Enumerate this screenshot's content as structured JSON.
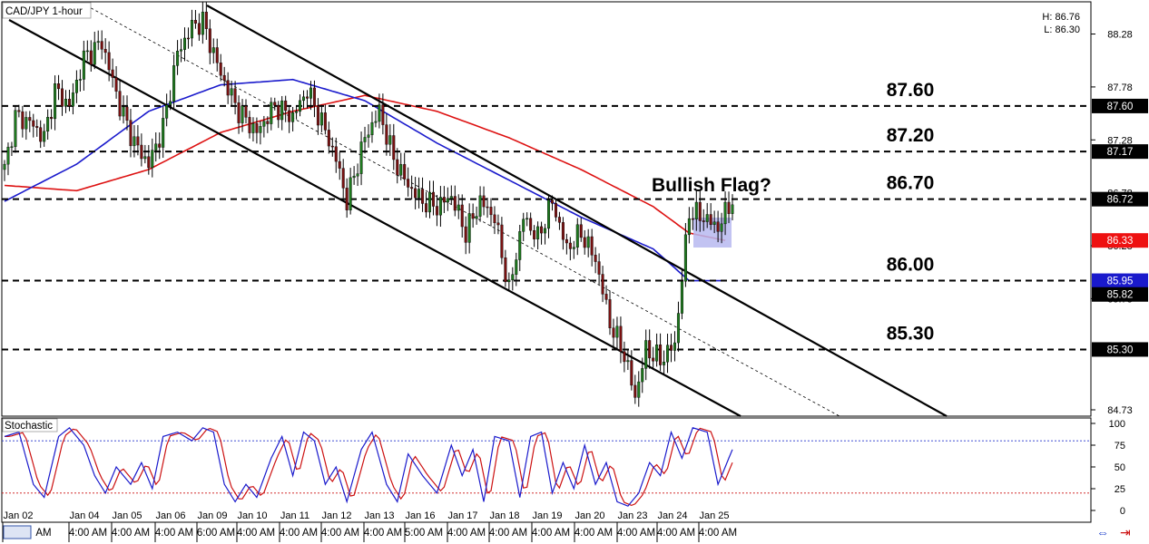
{
  "window": {
    "title": "CAD/JPY 1-hour",
    "stat_high": "H: 86.76",
    "stat_low": "L: 86.30"
  },
  "colors": {
    "price_line": "#000000",
    "candle_up": "#1e7a1e",
    "candle_down": "#7a1111",
    "ma_blue": "#1a1acc",
    "ma_red": "#dd1111",
    "stoch_k": "#1a1acc",
    "stoch_d": "#cc1111",
    "flag_fill": "#b7b8f0",
    "tag_dark": "#000000",
    "tag_red": "#ee1111",
    "tag_blue": "#1a1acc"
  },
  "chart_data": [
    {
      "type": "candlestick",
      "title": "CAD/JPY 1-hour",
      "ylim": [
        84.73,
        88.55
      ],
      "y_ticks": [
        "88.28",
        "87.78",
        "87.28",
        "86.78",
        "86.28",
        "85.78",
        "84.73"
      ],
      "levels": [
        {
          "value": 87.6,
          "label": "87.60",
          "tag": "87.60"
        },
        {
          "value": 87.17,
          "label": "87.20",
          "tag": "87.17"
        },
        {
          "value": 86.72,
          "label": "86.70",
          "tag": "86.72"
        },
        {
          "value": 85.95,
          "label": "86.00",
          "tag": "85.95"
        },
        {
          "value": 85.3,
          "label": "85.30",
          "tag": "85.30"
        }
      ],
      "price_tags": [
        {
          "value": 86.33,
          "label": "86.33",
          "style": "red"
        },
        {
          "value": 85.82,
          "label": "85.82",
          "style": "dark"
        }
      ],
      "annotation": "Bullish Flag?",
      "close_anchors": [
        {
          "t": 0,
          "p": 87.0
        },
        {
          "t": 3,
          "p": 87.5
        },
        {
          "t": 7,
          "p": 87.45
        },
        {
          "t": 11,
          "p": 87.3
        },
        {
          "t": 14,
          "p": 87.75
        },
        {
          "t": 18,
          "p": 87.6
        },
        {
          "t": 22,
          "p": 88.05
        },
        {
          "t": 27,
          "p": 88.2
        },
        {
          "t": 32,
          "p": 87.6
        },
        {
          "t": 36,
          "p": 87.25
        },
        {
          "t": 40,
          "p": 87.05
        },
        {
          "t": 44,
          "p": 87.4
        },
        {
          "t": 48,
          "p": 88.1
        },
        {
          "t": 52,
          "p": 88.35
        },
        {
          "t": 55,
          "p": 88.4
        },
        {
          "t": 60,
          "p": 87.9
        },
        {
          "t": 65,
          "p": 87.55
        },
        {
          "t": 70,
          "p": 87.35
        },
        {
          "t": 75,
          "p": 87.6
        },
        {
          "t": 80,
          "p": 87.5
        },
        {
          "t": 84,
          "p": 87.75
        },
        {
          "t": 88,
          "p": 87.45
        },
        {
          "t": 92,
          "p": 87.1
        },
        {
          "t": 95,
          "p": 86.7
        },
        {
          "t": 100,
          "p": 87.3
        },
        {
          "t": 104,
          "p": 87.55
        },
        {
          "t": 108,
          "p": 87.1
        },
        {
          "t": 112,
          "p": 86.85
        },
        {
          "t": 116,
          "p": 86.7
        },
        {
          "t": 120,
          "p": 86.65
        },
        {
          "t": 124,
          "p": 86.75
        },
        {
          "t": 128,
          "p": 86.4
        },
        {
          "t": 132,
          "p": 86.7
        },
        {
          "t": 136,
          "p": 86.55
        },
        {
          "t": 140,
          "p": 85.85
        },
        {
          "t": 144,
          "p": 86.55
        },
        {
          "t": 148,
          "p": 86.35
        },
        {
          "t": 152,
          "p": 86.7
        },
        {
          "t": 156,
          "p": 86.25
        },
        {
          "t": 160,
          "p": 86.4
        },
        {
          "t": 164,
          "p": 86.15
        },
        {
          "t": 168,
          "p": 85.55
        },
        {
          "t": 172,
          "p": 85.25
        },
        {
          "t": 175,
          "p": 84.85
        },
        {
          "t": 178,
          "p": 85.3
        },
        {
          "t": 182,
          "p": 85.2
        },
        {
          "t": 186,
          "p": 85.35
        },
        {
          "t": 190,
          "p": 86.6
        },
        {
          "t": 194,
          "p": 86.55
        },
        {
          "t": 198,
          "p": 86.45
        },
        {
          "t": 202,
          "p": 86.72
        }
      ],
      "ma_blue": [
        {
          "t": 0,
          "p": 86.7
        },
        {
          "t": 20,
          "p": 87.05
        },
        {
          "t": 40,
          "p": 87.55
        },
        {
          "t": 60,
          "p": 87.8
        },
        {
          "t": 80,
          "p": 87.85
        },
        {
          "t": 100,
          "p": 87.65
        },
        {
          "t": 120,
          "p": 87.25
        },
        {
          "t": 140,
          "p": 86.9
        },
        {
          "t": 160,
          "p": 86.55
        },
        {
          "t": 180,
          "p": 86.25
        },
        {
          "t": 190,
          "p": 85.95
        },
        {
          "t": 200,
          "p": 85.95
        }
      ],
      "ma_red": [
        {
          "t": 0,
          "p": 86.85
        },
        {
          "t": 20,
          "p": 86.8
        },
        {
          "t": 40,
          "p": 87.0
        },
        {
          "t": 60,
          "p": 87.35
        },
        {
          "t": 80,
          "p": 87.55
        },
        {
          "t": 100,
          "p": 87.7
        },
        {
          "t": 120,
          "p": 87.55
        },
        {
          "t": 140,
          "p": 87.3
        },
        {
          "t": 160,
          "p": 87.0
        },
        {
          "t": 180,
          "p": 86.65
        },
        {
          "t": 190,
          "p": 86.4
        },
        {
          "t": 200,
          "p": 86.33
        }
      ]
    },
    {
      "type": "line",
      "title": "Stochastic",
      "ylim": [
        0,
        100
      ],
      "y_ticks": [
        "100",
        "75",
        "50",
        "25",
        "0"
      ],
      "levels": [
        80,
        20
      ],
      "series_k": [
        {
          "t": 0,
          "v": 85
        },
        {
          "t": 4,
          "v": 90
        },
        {
          "t": 8,
          "v": 30
        },
        {
          "t": 11,
          "v": 15
        },
        {
          "t": 15,
          "v": 85
        },
        {
          "t": 18,
          "v": 95
        },
        {
          "t": 22,
          "v": 75
        },
        {
          "t": 25,
          "v": 40
        },
        {
          "t": 28,
          "v": 20
        },
        {
          "t": 31,
          "v": 50
        },
        {
          "t": 35,
          "v": 30
        },
        {
          "t": 38,
          "v": 55
        },
        {
          "t": 41,
          "v": 25
        },
        {
          "t": 44,
          "v": 85
        },
        {
          "t": 48,
          "v": 90
        },
        {
          "t": 52,
          "v": 80
        },
        {
          "t": 55,
          "v": 95
        },
        {
          "t": 58,
          "v": 90
        },
        {
          "t": 61,
          "v": 30
        },
        {
          "t": 64,
          "v": 10
        },
        {
          "t": 67,
          "v": 30
        },
        {
          "t": 70,
          "v": 15
        },
        {
          "t": 74,
          "v": 60
        },
        {
          "t": 77,
          "v": 85
        },
        {
          "t": 80,
          "v": 40
        },
        {
          "t": 83,
          "v": 90
        },
        {
          "t": 86,
          "v": 80
        },
        {
          "t": 89,
          "v": 30
        },
        {
          "t": 92,
          "v": 50
        },
        {
          "t": 95,
          "v": 10
        },
        {
          "t": 99,
          "v": 70
        },
        {
          "t": 102,
          "v": 90
        },
        {
          "t": 106,
          "v": 30
        },
        {
          "t": 109,
          "v": 10
        },
        {
          "t": 112,
          "v": 65
        },
        {
          "t": 116,
          "v": 40
        },
        {
          "t": 120,
          "v": 20
        },
        {
          "t": 124,
          "v": 75
        },
        {
          "t": 127,
          "v": 40
        },
        {
          "t": 130,
          "v": 70
        },
        {
          "t": 133,
          "v": 10
        },
        {
          "t": 136,
          "v": 85
        },
        {
          "t": 140,
          "v": 80
        },
        {
          "t": 143,
          "v": 15
        },
        {
          "t": 146,
          "v": 85
        },
        {
          "t": 149,
          "v": 90
        },
        {
          "t": 152,
          "v": 20
        },
        {
          "t": 155,
          "v": 55
        },
        {
          "t": 158,
          "v": 25
        },
        {
          "t": 161,
          "v": 75
        },
        {
          "t": 164,
          "v": 30
        },
        {
          "t": 167,
          "v": 55
        },
        {
          "t": 170,
          "v": 10
        },
        {
          "t": 173,
          "v": 5
        },
        {
          "t": 176,
          "v": 20
        },
        {
          "t": 179,
          "v": 55
        },
        {
          "t": 182,
          "v": 40
        },
        {
          "t": 185,
          "v": 90
        },
        {
          "t": 188,
          "v": 60
        },
        {
          "t": 191,
          "v": 95
        },
        {
          "t": 195,
          "v": 90
        },
        {
          "t": 198,
          "v": 30
        },
        {
          "t": 202,
          "v": 70
        }
      ]
    }
  ],
  "x_labels": [
    {
      "i": 0,
      "date": "Jan 02",
      "time": "AM"
    },
    {
      "i": 1,
      "date": "Jan 04",
      "time": "4:00 AM"
    },
    {
      "i": 2,
      "date": "Jan 05",
      "time": "4:00 AM"
    },
    {
      "i": 3,
      "date": "Jan 06",
      "time": "4:00 AM"
    },
    {
      "i": 4,
      "date": "Jan 09",
      "time": "6:00 AM"
    },
    {
      "i": 5,
      "date": "Jan 10",
      "time": "4:00 AM"
    },
    {
      "i": 6,
      "date": "Jan 11",
      "time": "4:00 AM"
    },
    {
      "i": 7,
      "date": "Jan 12",
      "time": "4:00 AM"
    },
    {
      "i": 8,
      "date": "Jan 13",
      "time": "4:00 AM"
    },
    {
      "i": 9,
      "date": "Jan 16",
      "time": "5:00 AM"
    },
    {
      "i": 10,
      "date": "Jan 17",
      "time": "4:00 AM"
    },
    {
      "i": 11,
      "date": "Jan 18",
      "time": "4:00 AM"
    },
    {
      "i": 12,
      "date": "Jan 19",
      "time": "4:00 AM"
    },
    {
      "i": 13,
      "date": "Jan 20",
      "time": "4:00 AM"
    },
    {
      "i": 14,
      "date": "Jan 23",
      "time": "4:00 AM"
    },
    {
      "i": 15,
      "date": "Jan 24",
      "time": "4:00 AM"
    },
    {
      "i": 16,
      "date": "Jan 25",
      "time": "4:00 AM"
    }
  ]
}
